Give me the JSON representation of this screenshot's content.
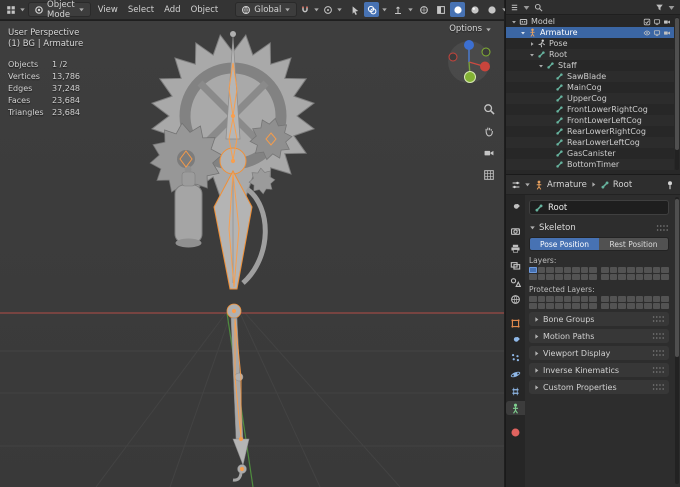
{
  "topbar": {
    "mode": "Object Mode",
    "menus": [
      "View",
      "Select",
      "Add",
      "Object"
    ],
    "orientation": "Global",
    "options_label": "Options",
    "right_icons": [
      {
        "icon": "cursor",
        "name": "select-tool"
      },
      {
        "icon": "overlays",
        "name": "overlays-toggle",
        "caret": true,
        "active": true
      },
      {
        "icon": "gizmo",
        "name": "gizmos-toggle",
        "caret": true
      },
      {
        "icon": "sphere-wire",
        "name": "shading-wireframe"
      },
      {
        "icon": "xray",
        "name": "xray-toggle"
      },
      {
        "icon": "sphere-solid",
        "name": "shading-solid",
        "active": true
      },
      {
        "icon": "sphere-material",
        "name": "shading-material"
      },
      {
        "icon": "sphere-rendered",
        "name": "shading-rendered",
        "caret": true
      }
    ]
  },
  "viewport": {
    "perspective_label": "User Perspective",
    "scene_label": "(1) BG | Armature",
    "stats": [
      {
        "label": "Objects",
        "value": "1 /2"
      },
      {
        "label": "Vertices",
        "value": "13,786"
      },
      {
        "label": "Edges",
        "value": "37,248"
      },
      {
        "label": "Faces",
        "value": "23,684"
      },
      {
        "label": "Triangles",
        "value": "23,684"
      }
    ],
    "side_tools": [
      {
        "icon": "zoom",
        "name": "zoom-tool"
      },
      {
        "icon": "hand",
        "name": "pan-hand-tool"
      },
      {
        "icon": "camera",
        "name": "camera-view-toggle"
      },
      {
        "icon": "gridico",
        "name": "viewport-grid-toggle"
      }
    ],
    "axis_colors": {
      "x": "#c9453c",
      "y": "#83b234",
      "z": "#3c6fd1"
    }
  },
  "outliner": {
    "rows": [
      {
        "label": "Model",
        "level": 0,
        "icon": "collection",
        "expanded": true,
        "right_icons": [
          "checkbox",
          "screen",
          "camera"
        ]
      },
      {
        "label": "Armature",
        "level": 1,
        "icon": "armature",
        "expanded": true,
        "selected": true,
        "right_icons": [
          "eye",
          "screen",
          "camera"
        ]
      },
      {
        "label": "Pose",
        "level": 2,
        "icon": "pose",
        "expanded": false
      },
      {
        "label": "Root",
        "level": 2,
        "icon": "bone",
        "expanded": true
      },
      {
        "label": "Staff",
        "level": 3,
        "icon": "bone",
        "expanded": true
      },
      {
        "label": "SawBlade",
        "level": 4,
        "icon": "bone"
      },
      {
        "label": "MainCog",
        "level": 4,
        "icon": "bone"
      },
      {
        "label": "UpperCog",
        "level": 4,
        "icon": "bone"
      },
      {
        "label": "FrontLowerRightCog",
        "level": 4,
        "icon": "bone"
      },
      {
        "label": "FrontLowerLeftCog",
        "level": 4,
        "icon": "bone"
      },
      {
        "label": "RearLowerRightCog",
        "level": 4,
        "icon": "bone"
      },
      {
        "label": "RearLowerLeftCog",
        "level": 4,
        "icon": "bone"
      },
      {
        "label": "GasCanister",
        "level": 4,
        "icon": "bone"
      },
      {
        "label": "BottomTimer",
        "level": 4,
        "icon": "bone"
      }
    ]
  },
  "properties": {
    "breadcrumb": {
      "object": "Armature",
      "data": "Root"
    },
    "name_value": "Root",
    "skeleton": {
      "title": "Skeleton",
      "pose_button": "Pose Position",
      "rest_button": "Rest Position",
      "layers_label": "Layers:",
      "protected_label": "Protected Layers:",
      "active_layer_index": 0
    },
    "sections": [
      "Bone Groups",
      "Motion Paths",
      "Viewport Display",
      "Inverse Kinematics",
      "Custom Properties"
    ],
    "active_tab": "object-data",
    "tabs": [
      {
        "id": "active-tool",
        "icon": "tool",
        "color": "#c0c0c0"
      },
      {
        "id": "render",
        "icon": "render",
        "color": "#c0c0c0",
        "gap": true
      },
      {
        "id": "output",
        "icon": "printer",
        "color": "#c0c0c0"
      },
      {
        "id": "view-layer",
        "icon": "images",
        "color": "#c0c0c0"
      },
      {
        "id": "scene",
        "icon": "scene",
        "color": "#c0c0c0"
      },
      {
        "id": "world",
        "icon": "globe",
        "color": "#c0c0c0"
      },
      {
        "id": "object",
        "icon": "object",
        "color": "#e58b4e",
        "gap": true
      },
      {
        "id": "modifiers",
        "icon": "modifier",
        "color": "#8fb8e8"
      },
      {
        "id": "particles",
        "icon": "particles",
        "color": "#8fb8e8"
      },
      {
        "id": "physics",
        "icon": "physics",
        "color": "#8fb8e8"
      },
      {
        "id": "constraints",
        "icon": "constraint",
        "color": "#8fb8e8"
      },
      {
        "id": "object-data",
        "icon": "armature",
        "color": "#7fd08f"
      },
      {
        "id": "material",
        "icon": "material",
        "color": "#e0635f",
        "gap": true
      }
    ]
  },
  "colors": {
    "accent_blue": "#4772b3",
    "selection_row_blue": "#3b66a4",
    "selected_outline_orange": "#ef9038",
    "bone_icon_teal": "#66b39e"
  }
}
